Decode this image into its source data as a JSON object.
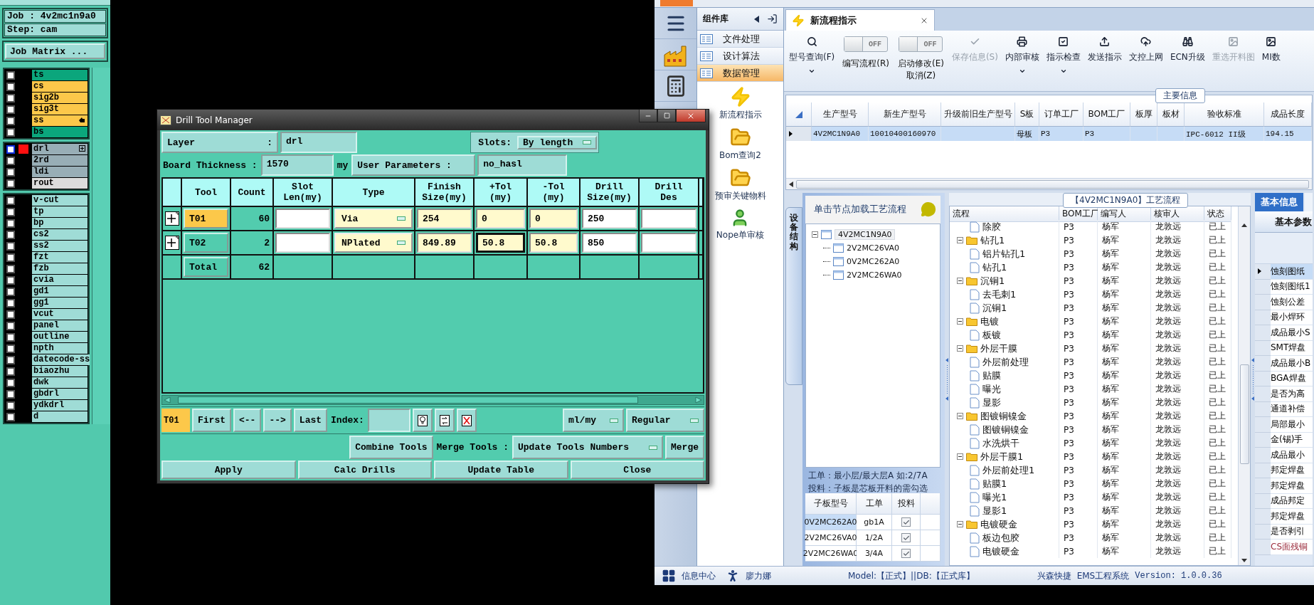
{
  "cam": {
    "job": "Job : 4v2mc1n9a0",
    "step": "Step: cam",
    "matrix_button": "Job Matrix ...",
    "layer_groups": [
      {
        "layers": [
          {
            "name": "ts",
            "color": "#0ba67c",
            "checked": false,
            "selected": false
          },
          {
            "name": "cs",
            "color": "#fcc84a",
            "checked": false,
            "selected": false
          },
          {
            "name": "sig2b",
            "color": "#fcc84a",
            "checked": false,
            "selected": false
          },
          {
            "name": "sig3t",
            "color": "#fcc84a",
            "checked": false,
            "selected": false
          },
          {
            "name": "ss",
            "color": "#fcc84a",
            "checked": false,
            "selected": false,
            "kind": "pointer"
          },
          {
            "name": "bs",
            "color": "#0ba67c",
            "checked": false,
            "selected": false
          }
        ]
      },
      {
        "layers": [
          {
            "name": "drl",
            "color": "#98aeb6",
            "checked": false,
            "selected": true,
            "kind": "expandable"
          },
          {
            "name": "2rd",
            "color": "#98aeb6",
            "checked": false,
            "selected": false
          },
          {
            "name": "ldi",
            "color": "#98aeb6",
            "checked": false,
            "selected": false
          },
          {
            "name": "rout",
            "color": "#dcdcdc",
            "checked": false,
            "selected": false
          }
        ]
      },
      {
        "layers": [
          {
            "name": "v-cut",
            "color": "#9fdcd6",
            "checked": false,
            "selected": false
          },
          {
            "name": "tp",
            "color": "#9fdcd6",
            "checked": false,
            "selected": false
          },
          {
            "name": "bp",
            "color": "#9fdcd6",
            "checked": false,
            "selected": false
          },
          {
            "name": "cs2",
            "color": "#9fdcd6",
            "checked": false,
            "selected": false
          },
          {
            "name": "ss2",
            "color": "#9fdcd6",
            "checked": false,
            "selected": false
          },
          {
            "name": "fzt",
            "color": "#9fdcd6",
            "checked": false,
            "selected": false
          },
          {
            "name": "fzb",
            "color": "#9fdcd6",
            "checked": false,
            "selected": false
          },
          {
            "name": "cvia",
            "color": "#9fdcd6",
            "checked": false,
            "selected": false
          },
          {
            "name": "gd1",
            "color": "#9fdcd6",
            "checked": false,
            "selected": false
          },
          {
            "name": "gg1",
            "color": "#9fdcd6",
            "checked": false,
            "selected": false
          },
          {
            "name": "vcut",
            "color": "#9fdcd6",
            "checked": false,
            "selected": false
          },
          {
            "name": "panel",
            "color": "#9fdcd6",
            "checked": false,
            "selected": false
          },
          {
            "name": "outline",
            "color": "#9fdcd6",
            "checked": false,
            "selected": false
          },
          {
            "name": "npth",
            "color": "#9fdcd6",
            "checked": false,
            "selected": false
          },
          {
            "name": "datecode-ss",
            "color": "#9fdcd6",
            "checked": false,
            "selected": false
          },
          {
            "name": "biaozhu",
            "color": "#9fdcd6",
            "checked": false,
            "selected": false
          },
          {
            "name": "dwk",
            "color": "#9fdcd6",
            "checked": false,
            "selected": false
          },
          {
            "name": "gbdrl",
            "color": "#9fdcd6",
            "checked": false,
            "selected": false
          },
          {
            "name": "ydkdrl",
            "color": "#9fdcd6",
            "checked": false,
            "selected": false
          },
          {
            "name": "d",
            "color": "#9fdcd6",
            "checked": false,
            "selected": false
          }
        ]
      }
    ]
  },
  "drill_tool_manager": {
    "title": "Drill Tool Manager",
    "layer_label": "Layer",
    "layer_colon": ":",
    "layer": "drl",
    "slots_label": "Slots:",
    "slots": "By length",
    "thickness_label": "Board Thickness :",
    "thickness": "1570",
    "thickness_unit": "my",
    "user_params_button": "User Parameters :",
    "user_params": "no_hasl",
    "columns": [
      "Tool",
      "Count",
      "Slot\nLen(my)",
      "Type",
      "Finish\nSize(my)",
      "+Tol\n(my)",
      "-Tol\n(my)",
      "Drill\nSize(my)",
      "Drill\nDes"
    ],
    "rows": [
      {
        "tool": "T01",
        "selected": true,
        "count": "60",
        "type": "Via",
        "finish": "254",
        "tol_plus": "0",
        "tol_plus_focused": false,
        "tol_minus": "0",
        "drill_size": "250"
      },
      {
        "tool": "T02",
        "selected": false,
        "count": "2",
        "type": "NPlated",
        "finish": "849.89",
        "tol_plus": "50.8",
        "tol_plus_focused": true,
        "tol_minus": "50.8",
        "drill_size": "850"
      }
    ],
    "total": {
      "label": "Total",
      "count": "62"
    },
    "nav": {
      "current": "T01",
      "first": "First",
      "prev": "<--",
      "next": "-->",
      "last": "Last",
      "index_label": "Index:",
      "units": "ml/my",
      "mode": "Regular"
    },
    "combine": "Combine Tools",
    "merge_label": "Merge Tools :",
    "merge_mode": "Update Tools Numbers",
    "merge": "Merge",
    "actions": [
      "Apply",
      "Calc Drills",
      "Update Table",
      "Close"
    ]
  },
  "ems": {
    "library_title": "组件库",
    "library_items": [
      {
        "label": "文件处理",
        "selected": false
      },
      {
        "label": "设计算法",
        "selected": false
      },
      {
        "label": "数据管理",
        "selected": true
      }
    ],
    "library_tools": [
      "新流程指示",
      "Bom查询2",
      "预审关键物料",
      "Nope单审核"
    ],
    "tab": "新流程指示",
    "toolbar": [
      {
        "kind": "button",
        "label": "型号查询(F)",
        "dropdown": true,
        "disabled": false
      },
      {
        "kind": "toggle",
        "label": "编写流程(R)",
        "state_text": "OFF",
        "on": false
      },
      {
        "kind": "toggle",
        "label": "启动修改(E)\n取消(Z)",
        "state_text": "OFF",
        "on": false
      },
      {
        "kind": "button",
        "label": "保存信息(S)",
        "dropdown": false,
        "disabled": true
      },
      {
        "kind": "button",
        "label": "内部审核",
        "dropdown": true,
        "disabled": false
      },
      {
        "kind": "button",
        "label": "指示检查",
        "dropdown": true,
        "disabled": false
      },
      {
        "kind": "button",
        "label": "发送指示",
        "dropdown": false,
        "disabled": false
      },
      {
        "kind": "button",
        "label": "文控上网",
        "dropdown": false,
        "disabled": false
      },
      {
        "kind": "button",
        "label": "ECN升级",
        "dropdown": false,
        "disabled": false
      },
      {
        "kind": "button",
        "label": "重选开料图",
        "dropdown": false,
        "disabled": true
      },
      {
        "kind": "button",
        "label": "MI数",
        "dropdown": false,
        "disabled": false
      }
    ],
    "main_info": {
      "title": "主要信息",
      "columns": [
        "生产型号",
        "新生产型号",
        "升级前旧生产型号",
        "S板",
        "订单工厂",
        "BOM工厂",
        "板厚",
        "板材",
        "验收标准",
        "成品长度"
      ],
      "rows": [
        {
          "selected": true,
          "cells": [
            "4V2MC1N9A0",
            "10010400160970",
            null,
            "母板",
            "P3",
            "P3",
            null,
            null,
            "IPC-6012 II级",
            "194.15"
          ]
        }
      ]
    },
    "structure_tab": "设备结构",
    "tree_hint": "单击节点加载工艺流程",
    "tree": [
      {
        "name": "4V2MC1N9A0",
        "expanded": true,
        "children": [
          {
            "name": "2V2MC26VA0"
          },
          {
            "name": "0V2MC262A0"
          },
          {
            "name": "2V2MC26WA0"
          }
        ]
      }
    ],
    "note": [
      "工单：最小层/最大层A 如:2/7A",
      "投料：子板是芯板开料的需勾选"
    ],
    "sub_table": {
      "columns": [
        "子板型号",
        "工单",
        "投料"
      ],
      "rows": [
        {
          "model": "0V2MC262A0",
          "order": "gb1A",
          "feed": true,
          "selected": true
        },
        {
          "model": "2V2MC26VA0",
          "order": "1/2A",
          "feed": true,
          "selected": false
        },
        {
          "model": "2V2MC26WA0",
          "order": "3/4A",
          "feed": true,
          "selected": false
        }
      ]
    },
    "flow_title": "【4V2MC1N9A0】工艺流程",
    "flow_columns": [
      "流程",
      "BOM工厂",
      "编写人",
      "核审人",
      "状态"
    ],
    "flow": [
      {
        "children": [
          {
            "name": "除胶",
            "bom": "P3",
            "writer": "杨军",
            "reviewer": "龙敦远",
            "status": "已上"
          }
        ]
      },
      {
        "name": "钻孔1",
        "bom": "P3",
        "writer": "杨军",
        "reviewer": "龙敦远",
        "status": "已上",
        "expanded": true,
        "children": [
          {
            "name": "铝片钻孔1",
            "bom": "P3",
            "writer": "杨军",
            "reviewer": "龙敦远",
            "status": "已上"
          },
          {
            "name": "钻孔1",
            "bom": "P3",
            "writer": "杨军",
            "reviewer": "龙敦远",
            "status": "已上"
          }
        ]
      },
      {
        "name": "沉铜1",
        "bom": "P3",
        "writer": "杨军",
        "reviewer": "龙敦远",
        "status": "已上",
        "expanded": true,
        "children": [
          {
            "name": "去毛刺1",
            "bom": "P3",
            "writer": "杨军",
            "reviewer": "龙敦远",
            "status": "已上"
          },
          {
            "name": "沉铜1",
            "bom": "P3",
            "writer": "杨军",
            "reviewer": "龙敦远",
            "status": "已上"
          }
        ]
      },
      {
        "name": "电镀",
        "bom": "P3",
        "writer": "杨军",
        "reviewer": "龙敦远",
        "status": "已上",
        "expanded": true,
        "children": [
          {
            "name": "板镀",
            "bom": "P3",
            "writer": "杨军",
            "reviewer": "龙敦远",
            "status": "已上"
          }
        ]
      },
      {
        "name": "外层干膜",
        "bom": "P3",
        "writer": "杨军",
        "reviewer": "龙敦远",
        "status": "已上",
        "expanded": true,
        "children": [
          {
            "name": "外层前处理",
            "bom": "P3",
            "writer": "杨军",
            "reviewer": "龙敦远",
            "status": "已上"
          },
          {
            "name": "贴膜",
            "bom": "P3",
            "writer": "杨军",
            "reviewer": "龙敦远",
            "status": "已上"
          },
          {
            "name": "曝光",
            "bom": "P3",
            "writer": "杨军",
            "reviewer": "龙敦远",
            "status": "已上"
          },
          {
            "name": "显影",
            "bom": "P3",
            "writer": "杨军",
            "reviewer": "龙敦远",
            "status": "已上"
          }
        ]
      },
      {
        "name": "图镀铜镍金",
        "bom": "P3",
        "writer": "杨军",
        "reviewer": "龙敦远",
        "status": "已上",
        "expanded": true,
        "children": [
          {
            "name": "图镀铜镍金",
            "bom": "P3",
            "writer": "杨军",
            "reviewer": "龙敦远",
            "status": "已上"
          },
          {
            "name": "水洗烘干",
            "bom": "P3",
            "writer": "杨军",
            "reviewer": "龙敦远",
            "status": "已上"
          }
        ]
      },
      {
        "name": "外层干膜1",
        "bom": "P3",
        "writer": "杨军",
        "reviewer": "龙敦远",
        "status": "已上",
        "expanded": true,
        "children": [
          {
            "name": "外层前处理1",
            "bom": "P3",
            "writer": "杨军",
            "reviewer": "龙敦远",
            "status": "已上"
          },
          {
            "name": "贴膜1",
            "bom": "P3",
            "writer": "杨军",
            "reviewer": "龙敦远",
            "status": "已上"
          },
          {
            "name": "曝光1",
            "bom": "P3",
            "writer": "杨军",
            "reviewer": "龙敦远",
            "status": "已上"
          },
          {
            "name": "显影1",
            "bom": "P3",
            "writer": "杨军",
            "reviewer": "龙敦远",
            "status": "已上"
          }
        ]
      },
      {
        "name": "电镀硬金",
        "bom": "P3",
        "writer": "杨军",
        "reviewer": "龙敦远",
        "status": "已上",
        "expanded": true,
        "children": [
          {
            "name": "板边包胶",
            "bom": "P3",
            "writer": "杨军",
            "reviewer": "龙敦远",
            "status": "已上"
          },
          {
            "name": "电镀硬金",
            "bom": "P3",
            "writer": "杨军",
            "reviewer": "龙敦远",
            "status": "已上"
          }
        ]
      }
    ],
    "side_tabs": [
      {
        "label": "基本信息",
        "selected": true
      },
      {
        "selected": false
      }
    ],
    "side_subtab": "基本参数",
    "params": [
      {
        "name": "蚀刻图纸",
        "selected": true,
        "warning": false
      },
      {
        "name": "蚀刻图纸1",
        "selected": false,
        "warning": false
      },
      {
        "name": "蚀刻公差",
        "selected": false,
        "warning": false
      },
      {
        "name": "最小焊环",
        "selected": false,
        "warning": false
      },
      {
        "name": "成品最小S",
        "selected": false,
        "warning": false
      },
      {
        "name": "SMT焊盘",
        "selected": false,
        "warning": false
      },
      {
        "name": "成品最小B",
        "selected": false,
        "warning": false
      },
      {
        "name": "BGA焊盘",
        "selected": false,
        "warning": false
      },
      {
        "name": "是否为高",
        "selected": false,
        "warning": false
      },
      {
        "name": "通道补偿",
        "selected": false,
        "warning": false
      },
      {
        "name": "局部最小",
        "selected": false,
        "warning": false
      },
      {
        "name": "金(锡)手",
        "selected": false,
        "warning": false
      },
      {
        "name": "成品最小",
        "selected": false,
        "warning": false
      },
      {
        "name": "邦定焊盘",
        "selected": false,
        "warning": false
      },
      {
        "name": "邦定焊盘",
        "selected": false,
        "warning": false
      },
      {
        "name": "成品邦定",
        "selected": false,
        "warning": false
      },
      {
        "name": "邦定焊盘",
        "selected": false,
        "warning": false
      },
      {
        "name": "是否剥引",
        "selected": false,
        "warning": false
      },
      {
        "name": "CS面残铜",
        "selected": false,
        "warning": true
      }
    ],
    "status": {
      "info_center": "信息中心",
      "user": "廖力娜",
      "model": "Model:【正式】||DB:【正式库】",
      "company": "兴森快捷",
      "system": "EMS工程系统",
      "version": "Version: 1.0.0.36"
    }
  }
}
